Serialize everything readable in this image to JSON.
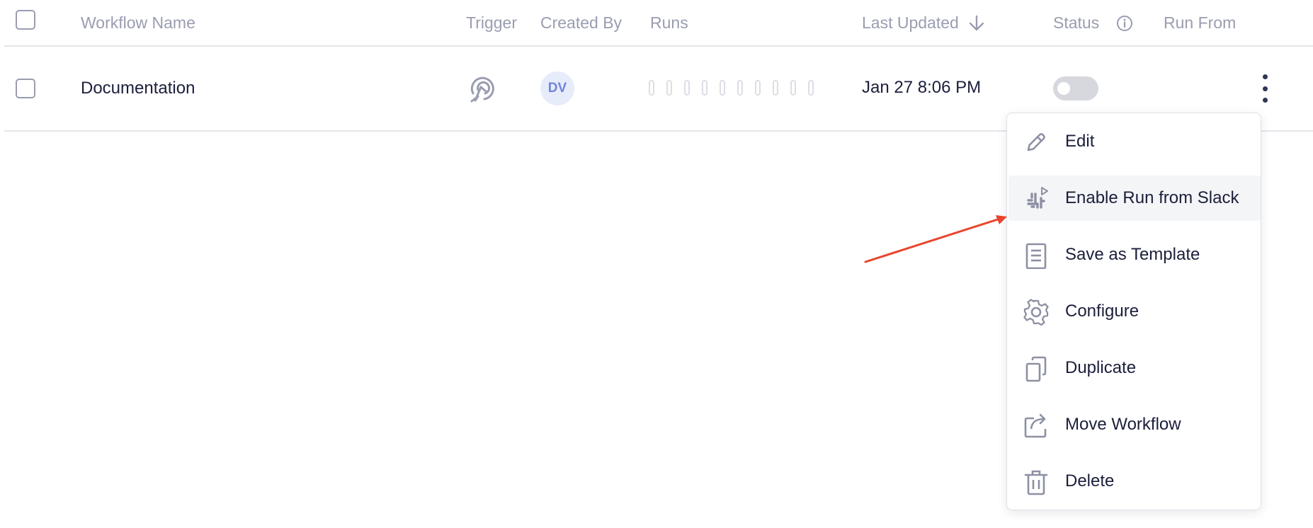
{
  "table": {
    "headers": {
      "workflow_name": "Workflow Name",
      "trigger": "Trigger",
      "created_by": "Created By",
      "runs": "Runs",
      "last_updated": "Last Updated",
      "status": "Status",
      "run_from": "Run From"
    },
    "sort": {
      "column": "last_updated",
      "direction": "descending",
      "icon": "arrow-down-icon"
    },
    "rows": [
      {
        "name": "Documentation",
        "trigger_icon": "trigger-target-icon",
        "created_by_initials": "DV",
        "runs_placeholder_count": 10,
        "last_updated": "Jan 27 8:06 PM",
        "status_enabled": false
      }
    ]
  },
  "context_menu": {
    "items": [
      {
        "label": "Edit",
        "icon": "pencil-icon"
      },
      {
        "label": "Enable Run from Slack",
        "icon": "slack-icon",
        "highlighted": true
      },
      {
        "label": "Save as Template",
        "icon": "template-icon"
      },
      {
        "label": "Configure",
        "icon": "gear-icon"
      },
      {
        "label": "Duplicate",
        "icon": "duplicate-icon"
      },
      {
        "label": "Move Workflow",
        "icon": "move-icon"
      },
      {
        "label": "Delete",
        "icon": "trash-icon"
      }
    ]
  },
  "annotation": {
    "type": "arrow",
    "color": "#e8452c",
    "points_to": "Enable Run from Slack"
  },
  "colors": {
    "text_primary": "#1b1f3b",
    "text_muted": "#9a9db0",
    "avatar_bg": "#e7ecfb",
    "avatar_text": "#6f86d8",
    "annotation_red": "#e8452c"
  }
}
